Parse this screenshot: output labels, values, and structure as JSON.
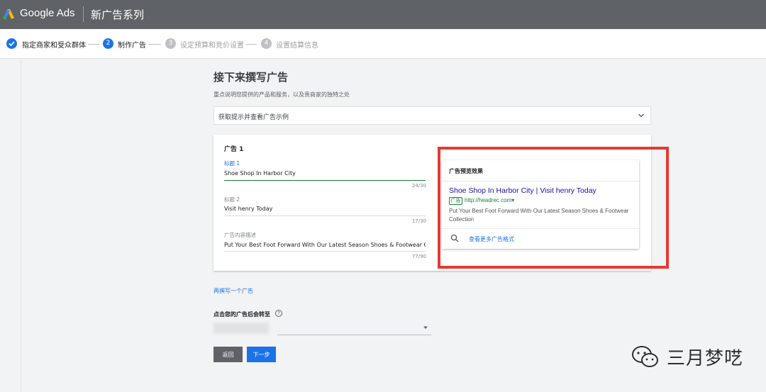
{
  "header": {
    "brand": "Google Ads",
    "campaign_title": "新广告系列"
  },
  "stepper": {
    "steps": [
      {
        "number": "1",
        "label": "指定商家和受众群体",
        "status": "done"
      },
      {
        "number": "2",
        "label": "制作广告",
        "status": "current"
      },
      {
        "number": "3",
        "label": "设定预算和竞价设置",
        "status": "todo"
      },
      {
        "number": "4",
        "label": "设置结算信息",
        "status": "todo"
      }
    ]
  },
  "main": {
    "title": "接下来撰写广告",
    "subtitle": "重点说明您提供的产品和服务，以及贵商家的独特之处",
    "tip_bar": "获取提示并查看广告示例"
  },
  "ad_card": {
    "title": "广告 1",
    "headline1": {
      "label": "标题 1",
      "value": "Shoe Shop In Harbor City",
      "counter": "24/30"
    },
    "headline2": {
      "label": "标题 2",
      "value": "Visit henry Today",
      "counter": "17/30"
    },
    "description": {
      "label": "广告内容描述",
      "value": "Put Your Best Foot Forward With Our Latest Season Shoes & Footwear Collec",
      "counter": "77/90"
    }
  },
  "preview": {
    "title": "广告预览效果",
    "headline": "Shoe Shop In Harbor City | Visit henry Today",
    "badge": "广告",
    "url": "http://headrec.com▾",
    "description": "Put Your Best Foot Forward With Our Latest Season Shoes & Footwear Collection",
    "more_link": "查看更多广告格式"
  },
  "actions": {
    "add_another": "再撰写一个广告",
    "final_url_label": "点击您的广告后会转至",
    "help": "?",
    "back": "返回",
    "next": "下一步"
  },
  "watermark": {
    "text": "三月梦呓"
  },
  "colors": {
    "header_bg": "#5f6368",
    "accent_blue": "#1a73e8",
    "highlight_red": "#e53935",
    "ad_green": "#188038"
  }
}
